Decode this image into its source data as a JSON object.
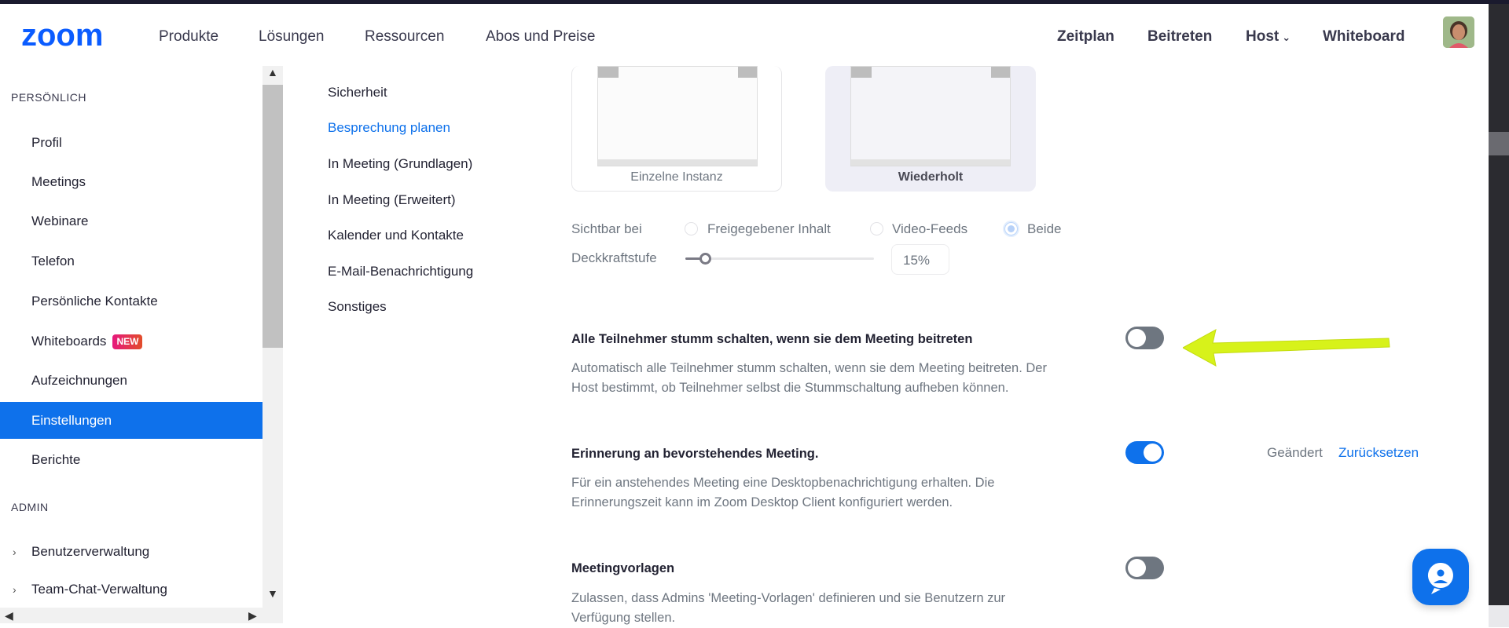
{
  "header": {
    "logo_text": "zoom",
    "nav": [
      "Produkte",
      "Lösungen",
      "Ressourcen",
      "Abos und Preise"
    ],
    "nav_right": [
      "Zeitplan",
      "Beitreten",
      "Host",
      "Whiteboard"
    ]
  },
  "sidebar": {
    "section_personal": "PERSÖNLICH",
    "items": [
      "Profil",
      "Meetings",
      "Webinare",
      "Telefon",
      "Persönliche Kontakte",
      "Whiteboards",
      "Aufzeichnungen",
      "Einstellungen",
      "Berichte"
    ],
    "new_badge": "NEW",
    "section_admin": "ADMIN",
    "admin_items": [
      "Benutzerverwaltung",
      "Team-Chat-Verwaltung"
    ]
  },
  "subnav": [
    "Sicherheit",
    "Besprechung planen",
    "In Meeting (Grundlagen)",
    "In Meeting (Erweitert)",
    "Kalender und Kontakte",
    "E-Mail-Benachrichtigung",
    "Sonstiges"
  ],
  "cards": {
    "single": "Einzelne Instanz",
    "repeated": "Wiederholt"
  },
  "visible": {
    "label": "Sichtbar bei",
    "options": [
      "Freigegebener Inhalt",
      "Video-Feeds",
      "Beide"
    ],
    "selected": "Beide"
  },
  "opacity": {
    "label": "Deckkraftstufe",
    "value": "15%",
    "level_percent": 15
  },
  "settings": [
    {
      "title": "Alle Teilnehmer stumm schalten, wenn sie dem Meeting beitreten",
      "desc_line1": "Automatisch alle Teilnehmer stumm schalten, wenn sie dem Meeting beitreten. Der",
      "desc_line2": "Host bestimmt, ob Teilnehmer selbst die Stummschaltung aufheben können.",
      "enabled": false
    },
    {
      "title": "Erinnerung an bevorstehendes Meeting.",
      "desc_line1": "Für ein anstehendes Meeting eine Desktopbenachrichtigung erhalten. Die",
      "desc_line2": "Erinnerungszeit kann im Zoom Desktop Client konfiguriert werden.",
      "enabled": true,
      "status": "Geändert",
      "reset": "Zurücksetzen"
    },
    {
      "title": "Meetingvorlagen",
      "desc_line1": "Zulassen, dass Admins 'Meeting-Vorlagen' definieren und sie Benutzern zur",
      "desc_line2": "Verfügung stellen.",
      "enabled": false
    }
  ],
  "colors": {
    "brand": "#0e71eb",
    "annotation_arrow": "#d7f21a"
  }
}
